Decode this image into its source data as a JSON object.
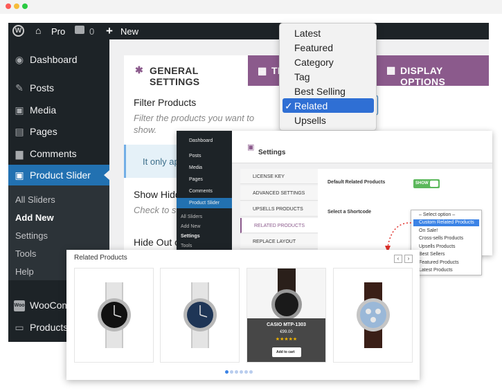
{
  "adminbar": {
    "site": "Pro",
    "comments": "0",
    "new": "New"
  },
  "sidebar": {
    "items": [
      {
        "label": "Dashboard",
        "icon": "dashboard-icon",
        "glyph": "◉"
      },
      {
        "label": "Posts",
        "icon": "pin-icon",
        "glyph": "✎"
      },
      {
        "label": "Media",
        "icon": "media-icon",
        "glyph": "▣"
      },
      {
        "label": "Pages",
        "icon": "pages-icon",
        "glyph": "▤"
      },
      {
        "label": "Comments",
        "icon": "comments-icon",
        "glyph": "▆"
      },
      {
        "label": "Product Slider",
        "icon": "cart-icon",
        "glyph": "🛒"
      }
    ],
    "sub": [
      "All Sliders",
      "Add New",
      "Settings",
      "Tools",
      "Help"
    ],
    "woo": "WooCom",
    "products": "Products"
  },
  "tabs": {
    "general": "GENERAL SETTINGS",
    "second": "TI",
    "display": "DISPLAY OPTIONS"
  },
  "filter": {
    "title": "Filter Products",
    "desc_1": "Filter the products you want to",
    "desc_2": "show."
  },
  "notice": "It only ap",
  "show_hidden": "Show Hidd",
  "check": "Check to s",
  "hide_out": "Hide Out o",
  "dropdown": {
    "options": [
      "Latest",
      "Featured",
      "Category",
      "Tag",
      "Best Selling",
      "Related",
      "Upsells"
    ],
    "selected": "Related",
    "check": "✓"
  },
  "inner": {
    "menu": [
      "Dashboard",
      "Posts",
      "Media",
      "Pages",
      "Comments",
      "Product Slider"
    ],
    "sub": [
      "All Sliders",
      "Add New",
      "Settings",
      "Tools"
    ],
    "heading": "Settings",
    "links": [
      "LICENSE KEY",
      "ADVANCED SETTINGS",
      "UPSELLS PRODUCTS",
      "RELATED PRODUCTS",
      "REPLACE LAYOUT"
    ],
    "default_related": "Default Related Products",
    "toggle": "SHOW",
    "select_shortcode": "Select a Shortcode",
    "options": [
      "– Select option –",
      "Custom Related Products",
      "On Sale!",
      "Cross-sells Products",
      "Upsells Products",
      "Best Sellers",
      "Featured Products",
      "Latest Products"
    ]
  },
  "related": {
    "title": "Related Products",
    "product_name": "CASIO MTP-1303",
    "price": "€99.00",
    "stars": "★★★★★",
    "add_to_cart": "Add to cart"
  },
  "colors": {
    "wp_blue": "#2271b1",
    "purple": "#8b5a8c",
    "dark": "#1d2327",
    "green": "#5cb85c"
  }
}
